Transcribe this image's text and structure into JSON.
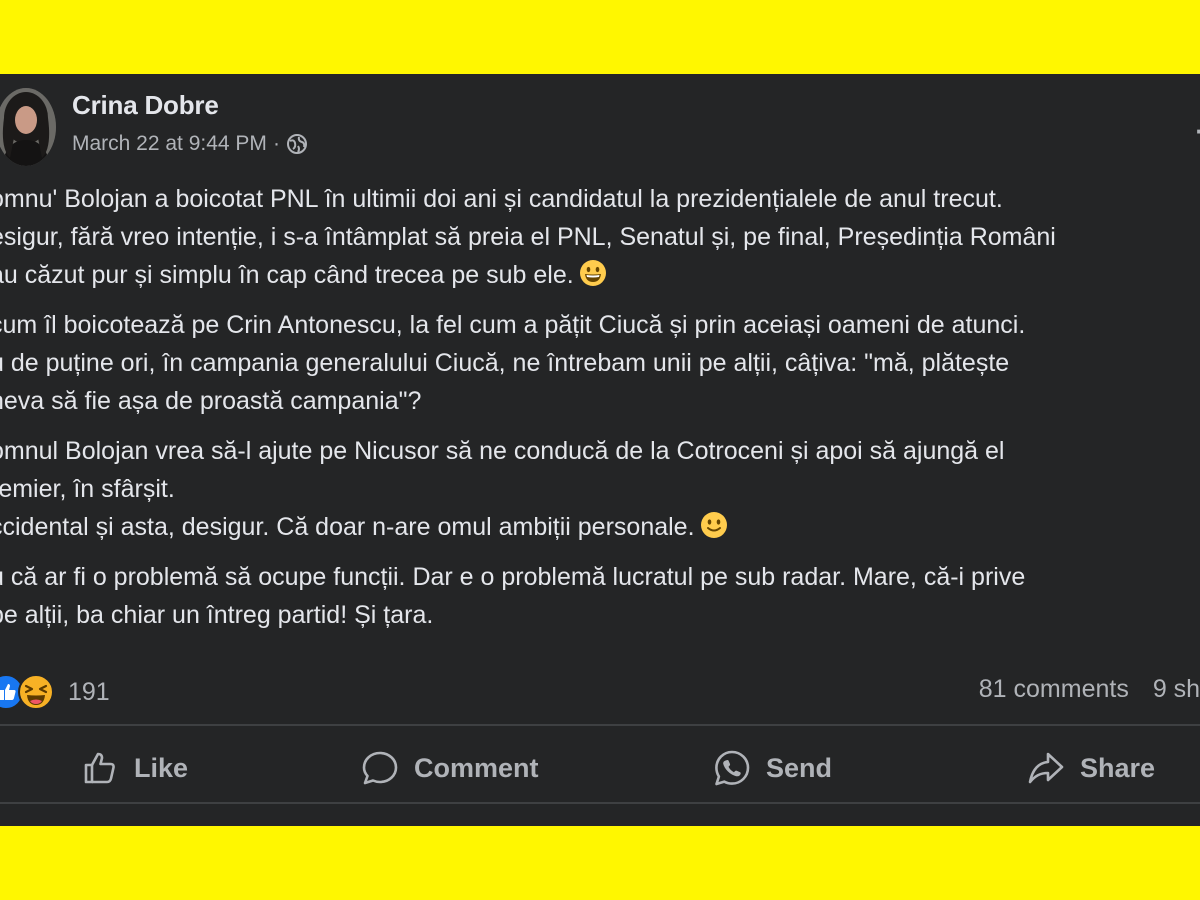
{
  "post": {
    "author": "Crina Dobre",
    "timestamp": "March 22 at 9:44 PM",
    "separator": "·",
    "paragraphs": [
      [
        "omnu' Bolojan a boicotat PNL în ultimii doi ani și candidatul la prezidențialele de anul trecut.",
        "esigur, fără vreo intenție, i s-a întâmplat să preia el PNL, Senatul și, pe final, Președinția Români",
        "au căzut pur și simplu în cap când trecea pe sub ele."
      ],
      [
        "cum îl boicotează pe Crin Antonescu, la fel cum a pățit Ciucă și prin aceiași oameni de atunci.",
        "u de puține ori, în campania generalului Ciucă, ne întrebam unii pe alții, câțiva: \"mă, plătește",
        "neva să fie așa de proastă campania\"?"
      ],
      [
        "omnul Bolojan vrea să-l ajute pe Nicusor să ne conducă de la Cotroceni și apoi să ajungă el",
        "remier, în sfârșit.",
        "ccidental și asta, desigur. Că doar n-are omul ambiții personale."
      ],
      [
        "u că ar fi o problemă să ocupe funcții. Dar e o problemă lucratul pe sub radar. Mare, că-i prive",
        " pe alții, ba chiar un întreg partid! Și țara."
      ]
    ]
  },
  "reactions": {
    "count": "191",
    "icons": [
      "like-reaction-icon",
      "haha-reaction-icon"
    ]
  },
  "stats": {
    "comments": "81 comments",
    "shares": "9 sha"
  },
  "actions": {
    "like": "Like",
    "comment": "Comment",
    "send": "Send",
    "share": "Share"
  },
  "colors": {
    "background_frame": "#fff700",
    "post_background": "#242526",
    "primary_text": "#e4e6eb",
    "secondary_text": "#b0b3b8",
    "like_blue": "#1877f2",
    "haha_yellow": "#f7b125"
  }
}
